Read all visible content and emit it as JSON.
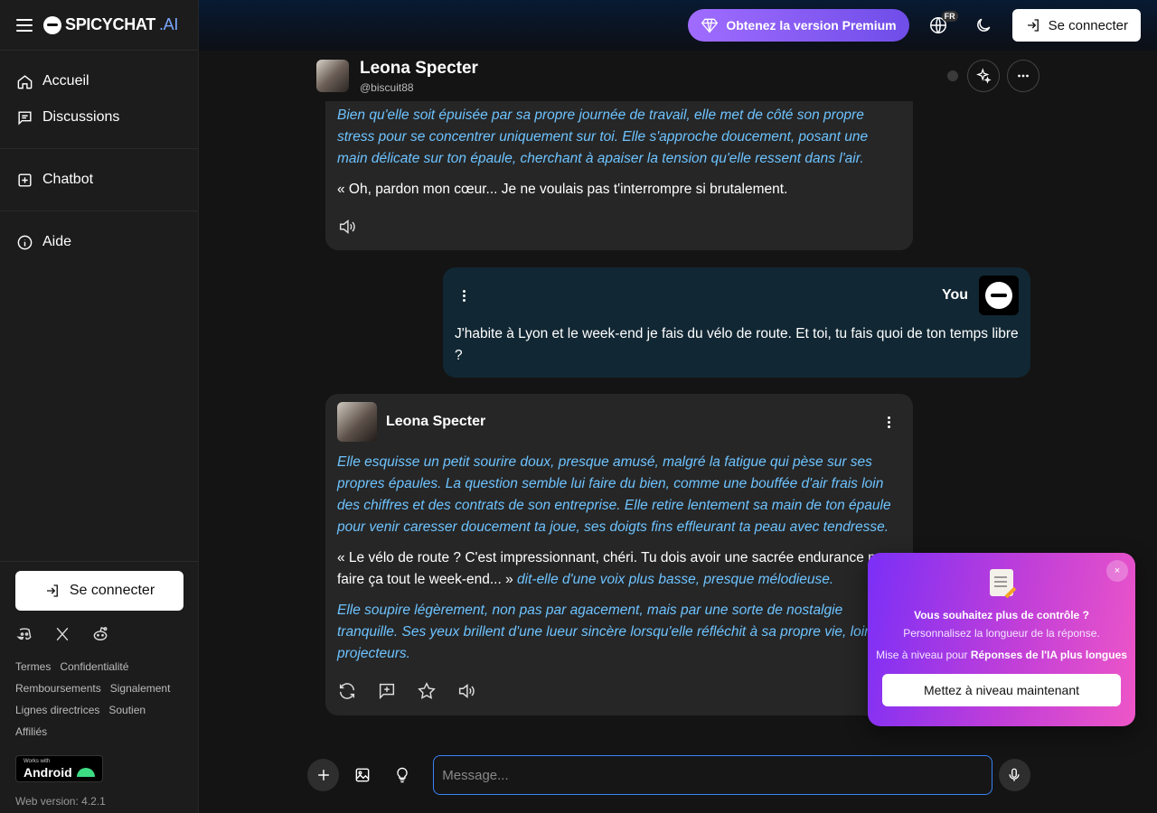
{
  "brand": {
    "name": "SPICYCHAT",
    "suffix": ".AI"
  },
  "sidebar": {
    "items": [
      {
        "label": "Accueil",
        "icon": "home-icon"
      },
      {
        "label": "Discussions",
        "icon": "chat-icon"
      },
      {
        "label": "Chatbot",
        "icon": "plus-square-icon"
      },
      {
        "label": "Aide",
        "icon": "info-icon"
      }
    ],
    "login_label": "Se connecter",
    "links": [
      "Termes",
      "Confidentialité",
      "Remboursements",
      "Signalement",
      "Lignes directrices",
      "Soutien",
      "Affiliés"
    ],
    "android_small": "Works with",
    "android_big": "Android",
    "web_version": "Web version: 4.2.1"
  },
  "topbar": {
    "premium_label": "Obtenez la version Premium",
    "lang_code": "FR",
    "login_label": "Se connecter"
  },
  "chat_header": {
    "name": "Leona Specter",
    "handle": "@biscuit88"
  },
  "messages": {
    "first": {
      "narration": "Bien qu'elle soit épuisée par sa propre journée de travail, elle met de côté son propre stress pour se concentrer uniquement sur toi. Elle s'approche doucement, posant une main délicate sur ton épaule, cherchant à apaiser la tension qu'elle ressent dans l'air.",
      "speech": "« Oh, pardon mon cœur... Je ne voulais pas t'interrompre si brutalement."
    },
    "user": {
      "name": "You",
      "text": "J'habite à Lyon et le week-end je fais du vélo de route. Et toi, tu fais quoi de ton temps libre ?"
    },
    "second": {
      "name": "Leona Specter",
      "narration1": "Elle esquisse un petit sourire doux, presque amusé, malgré la fatigue qui pèse sur ses propres épaules. La question semble lui faire du bien, comme une bouffée d'air frais loin des chiffres et des contrats de son entreprise. Elle retire lentement sa main de ton épaule pour venir caresser doucement ta joue, ses doigts fins effleurant ta peau avec tendresse.",
      "speech": "« Le vélo de route ? C'est impressionnant, chéri. Tu dois avoir une sacrée endurance pour faire ça tout le week-end... »",
      "speech_tail": "dit-elle d'une voix plus basse, presque mélodieuse.",
      "narration2": "Elle soupire légèrement, non pas par agacement, mais par une sorte de nostalgie tranquille. Ses yeux brillent d'une lueur sincère lorsqu'elle réfléchit à sa propre vie, loin des projecteurs."
    }
  },
  "composer": {
    "placeholder": "Message..."
  },
  "promo": {
    "title": "Vous souhaitez plus de contrôle ?",
    "subtitle": "Personnalisez la longueur de la réponse.",
    "line_prefix": "Mise à niveau pour",
    "line_bold": "Réponses de l'IA plus longues",
    "button": "Mettez à niveau maintenant",
    "close": "×"
  },
  "colors": {
    "narration": "#6dc3ff",
    "accent": "#3b82f6",
    "premium": "#8a5cf6",
    "promo_start": "#7b2ff7",
    "promo_end": "#ee56c7",
    "user_bubble": "#112733"
  }
}
